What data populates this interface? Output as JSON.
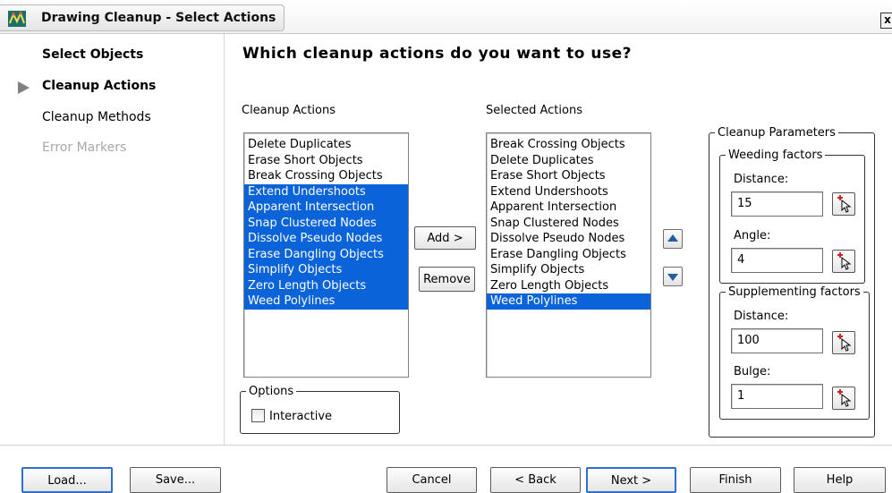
{
  "window": {
    "title": "Drawing Cleanup - Select Actions",
    "close_label": "x"
  },
  "nav": {
    "items": [
      {
        "label": "Select Objects",
        "state": "bold"
      },
      {
        "label": "Cleanup Actions",
        "state": "current"
      },
      {
        "label": "Cleanup Methods",
        "state": "normal"
      },
      {
        "label": "Error Markers",
        "state": "disabled"
      }
    ]
  },
  "main": {
    "heading": "Which cleanup actions do you want to use?",
    "available_label": "Cleanup Actions",
    "selected_label": "Selected Actions",
    "available": [
      {
        "label": "Delete Duplicates",
        "selected": false
      },
      {
        "label": "Erase Short Objects",
        "selected": false
      },
      {
        "label": "Break Crossing Objects",
        "selected": false
      },
      {
        "label": "Extend Undershoots",
        "selected": true
      },
      {
        "label": "Apparent Intersection",
        "selected": true
      },
      {
        "label": "Snap Clustered Nodes",
        "selected": true
      },
      {
        "label": "Dissolve Pseudo Nodes",
        "selected": true
      },
      {
        "label": "Erase Dangling Objects",
        "selected": true
      },
      {
        "label": "Simplify Objects",
        "selected": true
      },
      {
        "label": "Zero Length Objects",
        "selected": true
      },
      {
        "label": "Weed Polylines",
        "selected": true
      }
    ],
    "chosen": [
      {
        "label": "Break Crossing Objects",
        "selected": false
      },
      {
        "label": "Delete Duplicates",
        "selected": false
      },
      {
        "label": "Erase Short Objects",
        "selected": false
      },
      {
        "label": "Extend Undershoots",
        "selected": false
      },
      {
        "label": "Apparent Intersection",
        "selected": false
      },
      {
        "label": "Snap Clustered Nodes",
        "selected": false
      },
      {
        "label": "Dissolve Pseudo Nodes",
        "selected": false
      },
      {
        "label": "Erase Dangling Objects",
        "selected": false
      },
      {
        "label": "Simplify Objects",
        "selected": false
      },
      {
        "label": "Zero Length Objects",
        "selected": false
      },
      {
        "label": "Weed Polylines",
        "selected": true
      }
    ],
    "add_label": "Add >",
    "remove_label": "Remove",
    "options": {
      "legend": "Options",
      "interactive_label": "Interactive",
      "interactive_checked": false
    }
  },
  "params": {
    "legend": "Cleanup Parameters",
    "weeding": {
      "legend": "Weeding factors",
      "distance_label": "Distance:",
      "distance_value": "15",
      "angle_label": "Angle:",
      "angle_value": "4"
    },
    "supplementing": {
      "legend": "Supplementing factors",
      "distance_label": "Distance:",
      "distance_value": "100",
      "bulge_label": "Bulge:",
      "bulge_value": "1"
    }
  },
  "footer": {
    "load_label": "Load...",
    "save_label": "Save...",
    "cancel_label": "Cancel",
    "back_label": "< Back",
    "next_label": "Next >",
    "finish_label": "Finish",
    "help_label": "Help"
  },
  "colors": {
    "selection": "#0a63d8",
    "focus_border": "#2f6fcf",
    "disabled_text": "#a8a8a8"
  }
}
